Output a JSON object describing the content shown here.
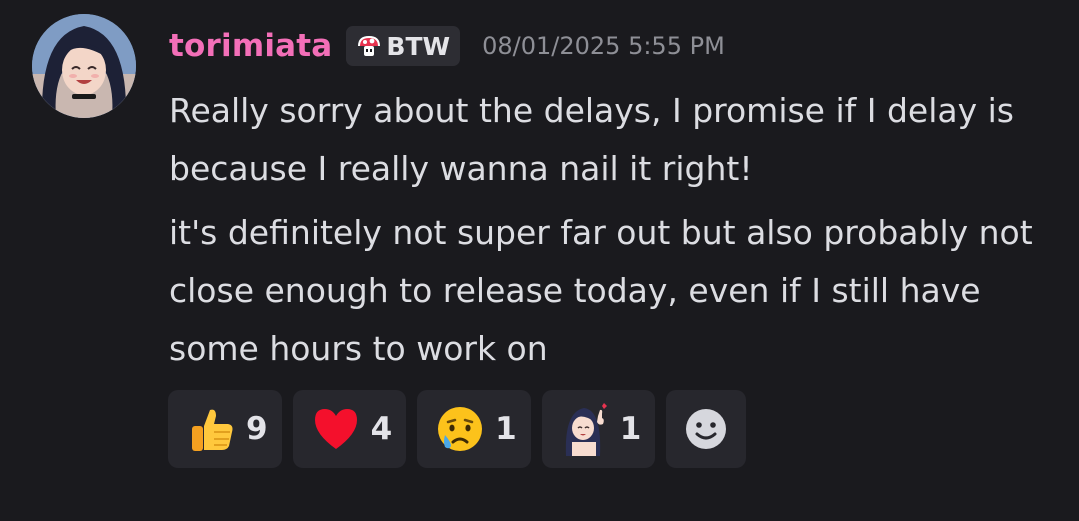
{
  "message": {
    "author": "torimiata",
    "author_color": "#f36fb8",
    "guild_tag": {
      "icon": "mushroom-icon",
      "label": "BTW"
    },
    "timestamp": "08/01/2025 5:55 PM",
    "paragraphs": [
      "Really sorry about the delays, I promise if I delay is because I really wanna nail it right!",
      "it's definitely not super far out but also probably not close enough to release today, even if I still have some hours to work on"
    ],
    "reactions": [
      {
        "icon": "thumbs-up-icon",
        "count": "9"
      },
      {
        "icon": "red-heart-icon",
        "count": "4"
      },
      {
        "icon": "sad-relieved-face-icon",
        "count": "1"
      },
      {
        "icon": "custom-anime-girl-emoji-icon",
        "count": "1"
      }
    ],
    "add_reaction_icon": "smiley-face-icon"
  },
  "colors": {
    "background": "#1a1a1e",
    "message_text": "#dcdde2",
    "timestamp": "#8e8f96",
    "reaction_bg": "#27272d"
  }
}
